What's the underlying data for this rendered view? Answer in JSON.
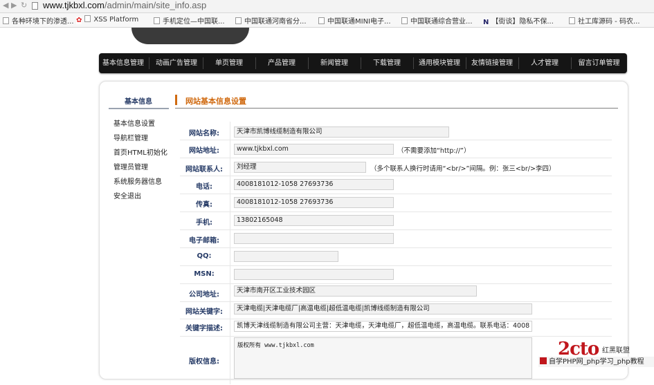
{
  "browser": {
    "url_host": "www.tjkbxl.com",
    "url_path": "/admin/main/site_info.asp",
    "bookmarks": [
      {
        "label": "各种环境下的渗透..."
      },
      {
        "label": "XSS Platform"
      },
      {
        "label": "手机定位—中国联..."
      },
      {
        "label": "中国联通河南省分..."
      },
      {
        "label": "中国联通MINI电子..."
      },
      {
        "label": "中国联通综合营业..."
      },
      {
        "label": "【街谈】隐私不保..."
      },
      {
        "label": "社工库源码 - 码农..."
      }
    ]
  },
  "menu": {
    "items": [
      "基本信息管理",
      "动画广告管理",
      "单页管理",
      "产品管理",
      "新闻管理",
      "下载管理",
      "通用模块管理",
      "友情链接管理",
      "人才管理",
      "留言订单管理"
    ]
  },
  "sidebar": {
    "title": "基本信息",
    "items": [
      "基本信息设置",
      "导航栏管理",
      "首页HTML初始化",
      "管理员管理",
      "系统服务器信息",
      "安全退出"
    ]
  },
  "main": {
    "title": "网站基本信息设置"
  },
  "form": {
    "site_name": {
      "label": "网站名称:",
      "value": "天津市凯博线缆制造有限公司"
    },
    "site_url": {
      "label": "网站地址:",
      "value": "www.tjkbxl.com",
      "hint": "（不需要添加“http://”）"
    },
    "contact": {
      "label": "网站联系人:",
      "value": "刘经理",
      "hint": "（多个联系人换行时请用“<br/>”间隔。例：张三<br/>李四）"
    },
    "phone": {
      "label": "电话:",
      "value": "4008181012-1058 27693736"
    },
    "fax": {
      "label": "传真:",
      "value": "4008181012-1058 27693736"
    },
    "mobile": {
      "label": "手机:",
      "value": "13802165048"
    },
    "email": {
      "label": "电子邮箱:",
      "value": ""
    },
    "qq": {
      "label": "QQ:",
      "value": ""
    },
    "msn": {
      "label": "MSN:",
      "value": ""
    },
    "address": {
      "label": "公司地址:",
      "value": "天津市南开区工业技术园区"
    },
    "keywords": {
      "label": "网站关键字:",
      "value": "天津电缆|天津电缆厂|高温电缆|超低温电缆|凯博线缆制造有限公司"
    },
    "description": {
      "label": "关键字描述:",
      "value": "凯博天津线缆制造有限公司主营：天津电缆，天津电缆厂，超低温电缆，高温电缆。联系电话：4008"
    },
    "copyright": {
      "label": "版权信息:",
      "value": "版权所有 www.tjkbxl.com"
    }
  },
  "watermark": {
    "logo": "2cto",
    "tag": "红黑联盟",
    "bar": "自学PHP网_php学习_php教程"
  }
}
